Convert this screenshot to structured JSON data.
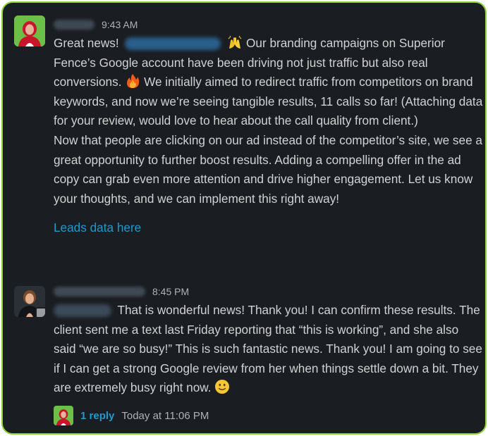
{
  "messages": [
    {
      "time": "9:43 AM",
      "paragraph1": [
        "Great news!",
        "Our branding campaigns on Superior Fence’s Google account have been driving not just traffic but also real conversions.",
        "We initially aimed to redirect traffic from competitors on brand keywords, and now we’re seeing tangible results, 11 calls so far! (Attaching data for your review, would love to hear about the call quality from client.)"
      ],
      "paragraph2": "Now that people are clicking on our ad instead of the competitor’s site, we see a great opportunity to further boost results. Adding a compelling offer in the ad copy can grab even more attention and drive higher engagement. Let us know your thoughts, and we can implement this right away!",
      "link": "Leads data here",
      "emojis": [
        "raising-hands",
        "fire"
      ]
    },
    {
      "time": "8:45 PM",
      "text": "That is wonderful news! Thank you! I can confirm these results. The client sent me a text last Friday reporting that “this is working”, and she also said “we are so busy!” This is such fantastic news. Thank you! I am going to see if I can get a strong Google review from her when things settle down a bit. They are extremely busy right now.",
      "emojis": [
        "slightly-smiling-face"
      ]
    }
  ],
  "thread": {
    "replies": "1 reply",
    "last_reply": "Today at 11:06 PM"
  },
  "colors": {
    "background": "#1a1d21",
    "border": "#8cd23c",
    "text": "#d1d2d3",
    "link": "#1d9bd1",
    "muted": "#aeb1b5"
  }
}
